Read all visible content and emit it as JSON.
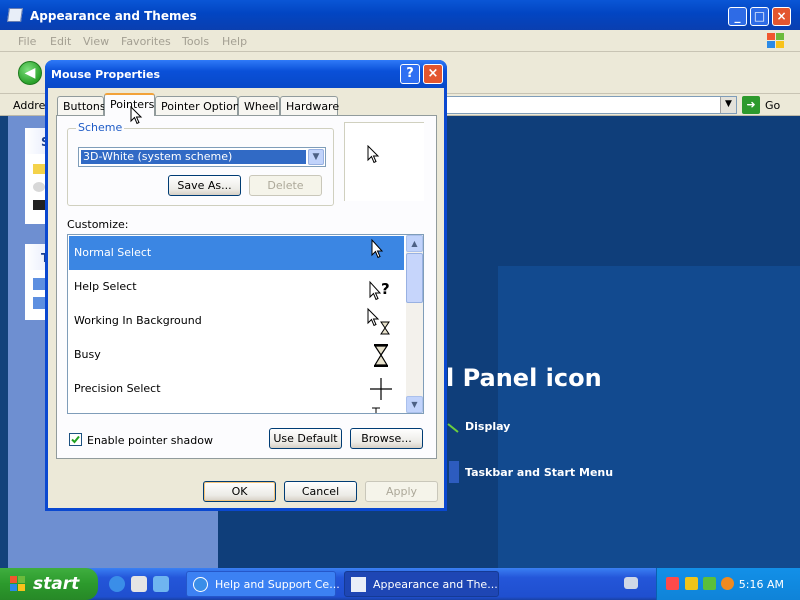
{
  "background_window": {
    "title": "Appearance and Themes",
    "menu": [
      "File",
      "Edit",
      "View",
      "Favorites",
      "Tools",
      "Help"
    ],
    "address_label": "Address",
    "go_label": "Go",
    "sidebar_headers": [
      "Se",
      "Tr"
    ],
    "main_heading": "l Panel icon",
    "links": [
      "Display",
      "Taskbar and Start Menu"
    ]
  },
  "dialog": {
    "title": "Mouse Properties",
    "tabs": [
      "Buttons",
      "Pointers",
      "Pointer Options",
      "Wheel",
      "Hardware"
    ],
    "selected_tab": "Pointers",
    "scheme": {
      "group_label": "Scheme",
      "selected": "3D-White (system scheme)",
      "save_as": "Save As...",
      "delete": "Delete"
    },
    "customize_label": "Customize:",
    "cursors": [
      {
        "name": "Normal Select",
        "icon": "arrow-cursor-icon",
        "selected": true
      },
      {
        "name": "Help Select",
        "icon": "help-cursor-icon",
        "selected": false
      },
      {
        "name": "Working In Background",
        "icon": "working-cursor-icon",
        "selected": false
      },
      {
        "name": "Busy",
        "icon": "hourglass-cursor-icon",
        "selected": false
      },
      {
        "name": "Precision Select",
        "icon": "crosshair-cursor-icon",
        "selected": false
      }
    ],
    "enable_shadow_label": "Enable pointer shadow",
    "enable_shadow_checked": true,
    "use_default": "Use Default",
    "browse": "Browse...",
    "ok": "OK",
    "cancel": "Cancel",
    "apply": "Apply"
  },
  "taskbar": {
    "start": "start",
    "tasks": [
      "Help and Support Ce...",
      "Appearance and The..."
    ],
    "clock": "5:16 AM"
  },
  "colors": {
    "selection": "#3b86e3",
    "title_blue": "#0a50d8",
    "start_green": "#2c9a2c"
  }
}
